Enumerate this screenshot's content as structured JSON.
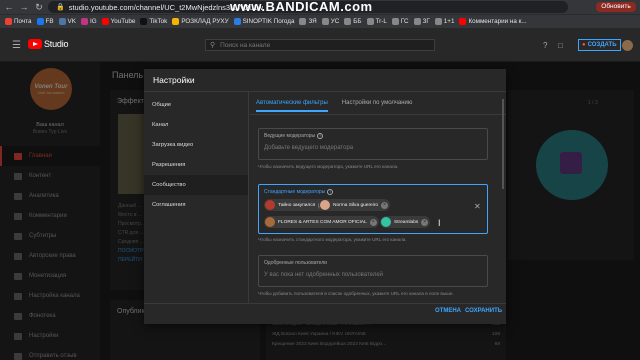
{
  "browser": {
    "url": "studio.youtube.com/channel/UC_t2MwNjedzlns3I1JV2u1w",
    "recorder_watermark": "www.BANDICAM.com",
    "update_button": "Обновить",
    "bookmarks": [
      {
        "label": "Почта",
        "color": "#ea4335"
      },
      {
        "label": "FB",
        "color": "#1877f2"
      },
      {
        "label": "VK",
        "color": "#4a76a8"
      },
      {
        "label": "IG",
        "color": "#c13584"
      },
      {
        "label": "YouTube",
        "color": "#ff0000"
      },
      {
        "label": "TikTok",
        "color": "#111111"
      },
      {
        "label": "РОЗКЛАД РУХУ",
        "color": "#f4b400"
      },
      {
        "label": "SINOPTIK Погода",
        "color": "#2a7de1"
      },
      {
        "label": "ЗЯ",
        "color": "#888888"
      },
      {
        "label": "УС",
        "color": "#888888"
      },
      {
        "label": "ББ",
        "color": "#888888"
      },
      {
        "label": "Tr-L",
        "color": "#888888"
      },
      {
        "label": "ГС",
        "color": "#888888"
      },
      {
        "label": "ЗГ",
        "color": "#888888"
      },
      {
        "label": "1+1",
        "color": "#888888"
      },
      {
        "label": "Комментарии на к...",
        "color": "#ff0000"
      }
    ]
  },
  "studio": {
    "logo_text": "Studio",
    "search_placeholder": "Поиск на канале",
    "create_label": "СОЗДАТЬ",
    "channel": {
      "avatar_line1": "Vonen Tour",
      "avatar_line2": "Visit Jerusalem",
      "title": "Ваш канал",
      "subtitle": "Вовен Тур Live"
    },
    "nav": [
      {
        "label": "Главная",
        "active": true
      },
      {
        "label": "Контент",
        "active": false
      },
      {
        "label": "Аналитика",
        "active": false
      },
      {
        "label": "Комментарии",
        "active": false
      },
      {
        "label": "Субтитры",
        "active": false
      },
      {
        "label": "Авторские права",
        "active": false
      },
      {
        "label": "Монетизация",
        "active": false
      },
      {
        "label": "Настройка канала",
        "active": false
      },
      {
        "label": "Фонотека",
        "active": false
      },
      {
        "label": "Настройки",
        "active": false
      },
      {
        "label": "Отправить отзыв",
        "active": false
      }
    ],
    "main": {
      "panel_title": "Панель",
      "card_left_title": "Эффект",
      "card_left_lines": [
        "Данный ...",
        "Место в ...",
        "Просмотр...",
        "CTR для ...",
        "Средняя ..."
      ],
      "card_left_link1": "ПОСМОТРЕТЬ",
      "card_left_link2": "ПЕРЕЙТИ",
      "card_bottom_title": "Опубликованные видео",
      "right_pager": "1 / 3",
      "bottom_rows": [
        {
          "text": "Киев сегодня • 18 марта 2022 Что и какие ...",
          "value": "332"
        },
        {
          "text": "ЖД Вокзал Киев Украина / KIEV UKRAINE",
          "value": "108"
        },
        {
          "text": "Крещение 2023 Киев Водорейша 2023 Київ Відро...",
          "value": "69"
        }
      ]
    }
  },
  "dialog": {
    "title": "Настройки",
    "side_items": [
      {
        "label": "Общие",
        "active": false
      },
      {
        "label": "Канал",
        "active": false
      },
      {
        "label": "Загрузка видео",
        "active": false
      },
      {
        "label": "Разрешения",
        "active": false
      },
      {
        "label": "Сообщество",
        "active": true
      },
      {
        "label": "Соглашения",
        "active": false
      }
    ],
    "tabs": [
      {
        "label": "Автоматические фильтры",
        "active": true
      },
      {
        "label": "Настройки по умолчанию",
        "active": false
      }
    ],
    "lead_moderator": {
      "label": "Ведущие модераторы",
      "placeholder": "Добавьте ведущего модератора",
      "hint": "Чтобы назначить ведущего модератора, укажите URL его канала."
    },
    "standard_moderators": {
      "label": "Стандартные модераторы",
      "chips": [
        {
          "name": "Тайно закупился",
          "avatar_color": "#b23a2e"
        },
        {
          "name": "Norma Silva guereiro",
          "avatar_color": "#d9a48a"
        },
        {
          "name": "FLORES & ARTES COM AMOR OFICIAL",
          "avatar_color": "#a86a3a"
        },
        {
          "name": "Streamlabs",
          "avatar_color": "#31c3a2"
        }
      ],
      "hint": "Чтобы назначить стандартного модератора, укажите URL его канала."
    },
    "approved_users": {
      "label": "Одобренные пользователи",
      "placeholder": "У вас пока нет одобренных пользователей",
      "hint": "Чтобы добавить пользователя в список одобренных, укажите URL его канала в поле выше."
    },
    "cancel_label": "ОТМЕНА",
    "save_label": "СОХРАНИТЬ"
  },
  "colors": {
    "accent": "#3ea6ff",
    "active_nav": "#ff4e45",
    "dialog_bg": "#282828"
  }
}
